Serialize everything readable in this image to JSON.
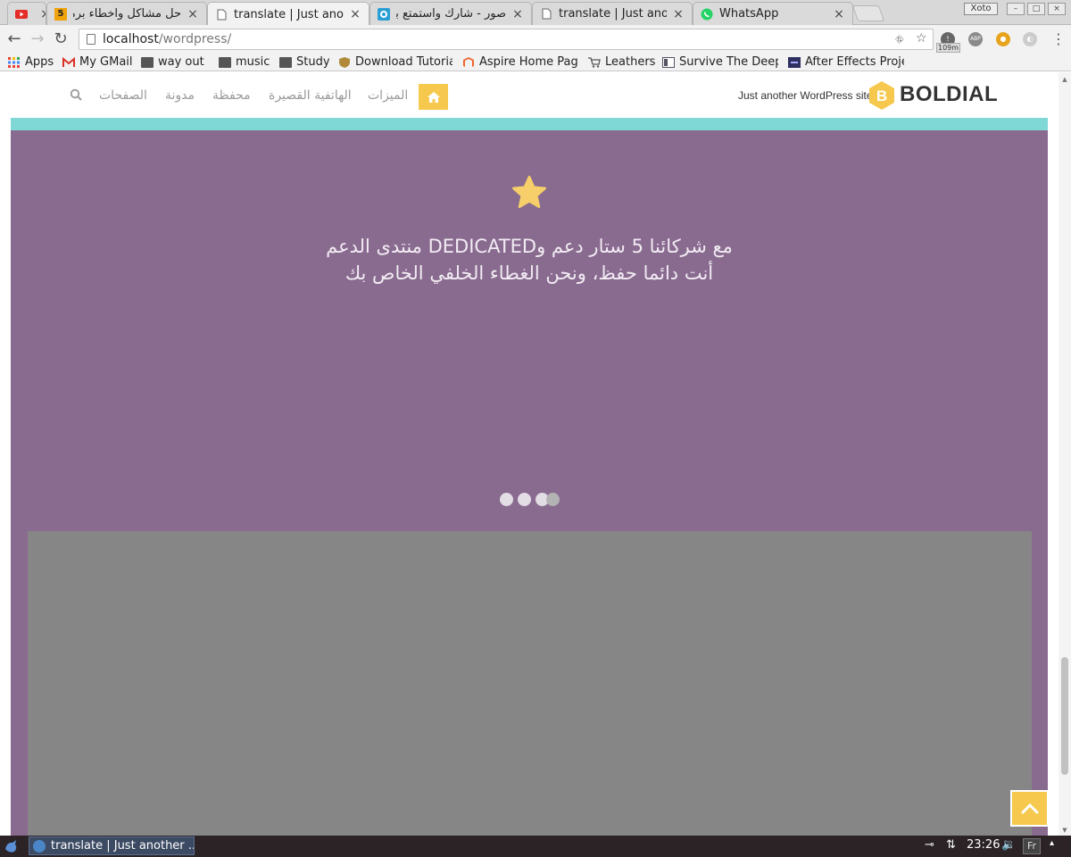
{
  "browser": {
    "tabs": [
      {
        "title": "",
        "favicon": "youtube-icon",
        "active": false
      },
      {
        "title": "حل مشاكل واخطاء برمجة",
        "favicon": "html5-icon",
        "active": false
      },
      {
        "title": "translate | Just anoth",
        "favicon": "page-icon",
        "active": true
      },
      {
        "title": "صور - شارك واستمتع با",
        "favicon": "photos-icon",
        "active": false
      },
      {
        "title": "translate | Just anoth",
        "favicon": "page-icon",
        "active": false
      },
      {
        "title": "WhatsApp",
        "favicon": "whatsapp-icon",
        "active": false
      }
    ],
    "user_badge": "Xoto",
    "url_host": "localhost",
    "url_path": "/wordpress/",
    "ext_badge": "109m",
    "bookmarks": [
      {
        "label": "Apps",
        "icon": "apps-grid-icon"
      },
      {
        "label": "My GMail",
        "icon": "gmail-icon"
      },
      {
        "label": "way out",
        "icon": "folder-icon"
      },
      {
        "label": "music",
        "icon": "folder-icon"
      },
      {
        "label": "Study",
        "icon": "folder-icon"
      },
      {
        "label": "Download Tutorial",
        "icon": "shield-icon"
      },
      {
        "label": "Aspire Home Page",
        "icon": "magento-icon"
      },
      {
        "label": "Leathers",
        "icon": "cart-icon"
      },
      {
        "label": "Survive The Deep",
        "icon": "book-icon"
      },
      {
        "label": "After Effects Proje",
        "icon": "ae-icon"
      }
    ]
  },
  "site": {
    "logo_text": "BOLDIAL",
    "logo_letter": "B",
    "tagline": "Just another WordPress site",
    "nav": [
      "الميزات",
      "الهاتفية القصيرة",
      "محفظة",
      "مدونة",
      "الصفحات"
    ],
    "colors": {
      "accent": "#f6c94e",
      "teal": "#7fd8d6",
      "purple": "#896b90",
      "gray_block": "#868686"
    }
  },
  "hero": {
    "line1": "مع شركائنا 5 ستار دعم وDEDICATED منتدى الدعم",
    "line2": "أنت دائما حفظ، ونحن الغطاء الخلفي الخاص بك",
    "slides_total": 4,
    "slide_active": 4
  },
  "taskbar": {
    "task_label": "translate | Just another ...",
    "clock": "23:26",
    "keyboard_layout": "Fr"
  }
}
